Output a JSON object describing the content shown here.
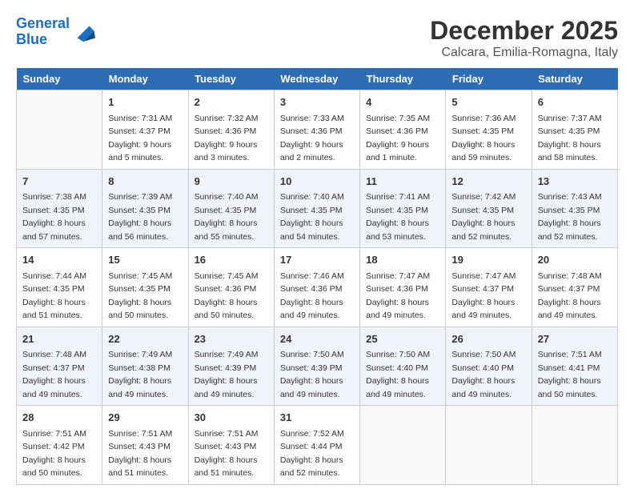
{
  "header": {
    "logo_line1": "General",
    "logo_line2": "Blue",
    "month": "December 2025",
    "location": "Calcara, Emilia-Romagna, Italy"
  },
  "weekdays": [
    "Sunday",
    "Monday",
    "Tuesday",
    "Wednesday",
    "Thursday",
    "Friday",
    "Saturday"
  ],
  "weeks": [
    [
      {
        "day": "",
        "sunrise": "",
        "sunset": "",
        "daylight": ""
      },
      {
        "day": "1",
        "sunrise": "7:31 AM",
        "sunset": "4:37 PM",
        "daylight": "9 hours and 5 minutes."
      },
      {
        "day": "2",
        "sunrise": "7:32 AM",
        "sunset": "4:36 PM",
        "daylight": "9 hours and 3 minutes."
      },
      {
        "day": "3",
        "sunrise": "7:33 AM",
        "sunset": "4:36 PM",
        "daylight": "9 hours and 2 minutes."
      },
      {
        "day": "4",
        "sunrise": "7:35 AM",
        "sunset": "4:36 PM",
        "daylight": "9 hours and 1 minute."
      },
      {
        "day": "5",
        "sunrise": "7:36 AM",
        "sunset": "4:35 PM",
        "daylight": "8 hours and 59 minutes."
      },
      {
        "day": "6",
        "sunrise": "7:37 AM",
        "sunset": "4:35 PM",
        "daylight": "8 hours and 58 minutes."
      }
    ],
    [
      {
        "day": "7",
        "sunrise": "7:38 AM",
        "sunset": "4:35 PM",
        "daylight": "8 hours and 57 minutes."
      },
      {
        "day": "8",
        "sunrise": "7:39 AM",
        "sunset": "4:35 PM",
        "daylight": "8 hours and 56 minutes."
      },
      {
        "day": "9",
        "sunrise": "7:40 AM",
        "sunset": "4:35 PM",
        "daylight": "8 hours and 55 minutes."
      },
      {
        "day": "10",
        "sunrise": "7:40 AM",
        "sunset": "4:35 PM",
        "daylight": "8 hours and 54 minutes."
      },
      {
        "day": "11",
        "sunrise": "7:41 AM",
        "sunset": "4:35 PM",
        "daylight": "8 hours and 53 minutes."
      },
      {
        "day": "12",
        "sunrise": "7:42 AM",
        "sunset": "4:35 PM",
        "daylight": "8 hours and 52 minutes."
      },
      {
        "day": "13",
        "sunrise": "7:43 AM",
        "sunset": "4:35 PM",
        "daylight": "8 hours and 52 minutes."
      }
    ],
    [
      {
        "day": "14",
        "sunrise": "7:44 AM",
        "sunset": "4:35 PM",
        "daylight": "8 hours and 51 minutes."
      },
      {
        "day": "15",
        "sunrise": "7:45 AM",
        "sunset": "4:35 PM",
        "daylight": "8 hours and 50 minutes."
      },
      {
        "day": "16",
        "sunrise": "7:45 AM",
        "sunset": "4:36 PM",
        "daylight": "8 hours and 50 minutes."
      },
      {
        "day": "17",
        "sunrise": "7:46 AM",
        "sunset": "4:36 PM",
        "daylight": "8 hours and 49 minutes."
      },
      {
        "day": "18",
        "sunrise": "7:47 AM",
        "sunset": "4:36 PM",
        "daylight": "8 hours and 49 minutes."
      },
      {
        "day": "19",
        "sunrise": "7:47 AM",
        "sunset": "4:37 PM",
        "daylight": "8 hours and 49 minutes."
      },
      {
        "day": "20",
        "sunrise": "7:48 AM",
        "sunset": "4:37 PM",
        "daylight": "8 hours and 49 minutes."
      }
    ],
    [
      {
        "day": "21",
        "sunrise": "7:48 AM",
        "sunset": "4:37 PM",
        "daylight": "8 hours and 49 minutes."
      },
      {
        "day": "22",
        "sunrise": "7:49 AM",
        "sunset": "4:38 PM",
        "daylight": "8 hours and 49 minutes."
      },
      {
        "day": "23",
        "sunrise": "7:49 AM",
        "sunset": "4:39 PM",
        "daylight": "8 hours and 49 minutes."
      },
      {
        "day": "24",
        "sunrise": "7:50 AM",
        "sunset": "4:39 PM",
        "daylight": "8 hours and 49 minutes."
      },
      {
        "day": "25",
        "sunrise": "7:50 AM",
        "sunset": "4:40 PM",
        "daylight": "8 hours and 49 minutes."
      },
      {
        "day": "26",
        "sunrise": "7:50 AM",
        "sunset": "4:40 PM",
        "daylight": "8 hours and 49 minutes."
      },
      {
        "day": "27",
        "sunrise": "7:51 AM",
        "sunset": "4:41 PM",
        "daylight": "8 hours and 50 minutes."
      }
    ],
    [
      {
        "day": "28",
        "sunrise": "7:51 AM",
        "sunset": "4:42 PM",
        "daylight": "8 hours and 50 minutes."
      },
      {
        "day": "29",
        "sunrise": "7:51 AM",
        "sunset": "4:43 PM",
        "daylight": "8 hours and 51 minutes."
      },
      {
        "day": "30",
        "sunrise": "7:51 AM",
        "sunset": "4:43 PM",
        "daylight": "8 hours and 51 minutes."
      },
      {
        "day": "31",
        "sunrise": "7:52 AM",
        "sunset": "4:44 PM",
        "daylight": "8 hours and 52 minutes."
      },
      {
        "day": "",
        "sunrise": "",
        "sunset": "",
        "daylight": ""
      },
      {
        "day": "",
        "sunrise": "",
        "sunset": "",
        "daylight": ""
      },
      {
        "day": "",
        "sunrise": "",
        "sunset": "",
        "daylight": ""
      }
    ]
  ]
}
